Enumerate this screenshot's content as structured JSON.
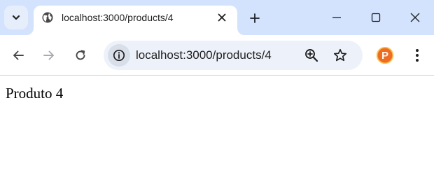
{
  "tab": {
    "title": "localhost:3000/products/4",
    "favicon": "globe-icon"
  },
  "omnibox": {
    "url": "localhost:3000/products/4"
  },
  "toolbar": {
    "back_icon": "back-arrow-icon",
    "forward_icon": "forward-arrow-icon",
    "reload_icon": "reload-icon",
    "zoom_icon": "zoom-in-icon",
    "bookmark_icon": "star-icon",
    "menu_icon": "kebab-menu-icon"
  },
  "profile": {
    "letter": "P",
    "color": "#f26b22"
  },
  "page": {
    "text": "Produto 4"
  },
  "colors": {
    "tabbar_bg": "#d3e3fd",
    "omnibox_bg": "#edf2fa",
    "icon": "#474747",
    "icon_disabled": "#a8abb0"
  }
}
